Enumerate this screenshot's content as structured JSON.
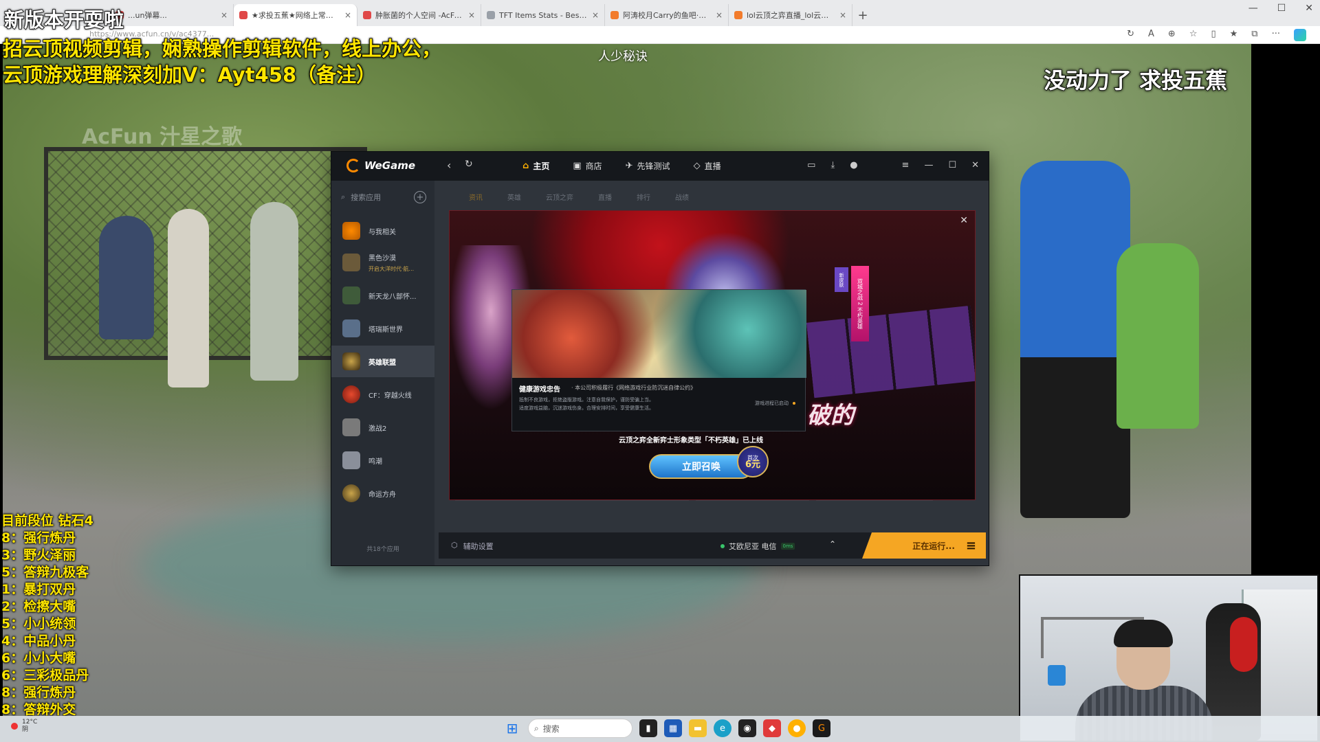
{
  "browser": {
    "tabs": [
      {
        "label": "...un弹幕..."
      },
      {
        "label": "★求投五蕉★网络上常见的热门..."
      },
      {
        "label": "肿胀菌的个人空间 -AcFun弹幕..."
      },
      {
        "label": "TFT Items Stats - Best Items for S..."
      },
      {
        "label": "阿涛校月Carry的鱼吧·斗鱼社区..."
      },
      {
        "label": "lol云顶之弈直播_lol云顶之弈直..."
      }
    ],
    "new_tab": "+",
    "window_controls": {
      "minimize": "—",
      "maximize": "☐",
      "close": "✕"
    },
    "address": "https://www.acfun.cn/v/ac4377..."
  },
  "video": {
    "watermark": "AcFun 汁星之歌",
    "promo_title": "新版本开耍啦",
    "promo_line1": "招云顶视频剪辑，娴熟操作剪辑软件，线上办公，",
    "promo_line2": "云顶游戏理解深刻加V：Ayt458（备注）",
    "center_caption": "人少秘诀",
    "right_caption": "没动力了 求投五蕉",
    "rank_header": "目前段位 钻石4",
    "rank_list": [
      "8：强行炼丹",
      "3：野火泽丽",
      "5：答辩九极客",
      "1：暴打双丹",
      "2：检擦大嘴",
      "5：小小统领",
      "4：中品小丹",
      "6：小小大嘴",
      "6：三彩极品丹",
      "8：强行炼丹",
      "8：答辩外交"
    ]
  },
  "wegame": {
    "logo": "WeGame",
    "nav": {
      "back": "‹",
      "refresh": "↻"
    },
    "tabs": [
      {
        "label": "主页",
        "icon": "home-icon",
        "active": true
      },
      {
        "label": "商店",
        "icon": "shop-icon",
        "active": false
      },
      {
        "label": "先锋测试",
        "icon": "test-icon",
        "active": false
      },
      {
        "label": "直播",
        "icon": "live-icon",
        "active": false
      }
    ],
    "sidebar": {
      "search_placeholder": "搜索应用",
      "items": [
        {
          "label": "与我相关",
          "sub": ""
        },
        {
          "label": "黑色沙漠",
          "sub": "开启大洋时代·航..."
        },
        {
          "label": "新天龙八部怀...",
          "sub": ""
        },
        {
          "label": "塔瑞斯世界",
          "sub": ""
        },
        {
          "label": "英雄联盟",
          "sub": "",
          "active": true
        },
        {
          "label": "CF：穿越火线",
          "sub": ""
        },
        {
          "label": "激战2",
          "sub": ""
        },
        {
          "label": "鸣潮",
          "sub": ""
        },
        {
          "label": "命运方舟",
          "sub": ""
        }
      ],
      "count": "共18个应用"
    },
    "subtabs": [
      "资讯",
      "英雄",
      "云顶之弈",
      "直播",
      "排行",
      "战绩"
    ],
    "popup": {
      "close": "✕",
      "banner_vertical": "双城之战 2 不朽英雄",
      "banner_small": "新皮肤",
      "big_text": "破的",
      "health_title": "健康游戏忠告",
      "health_pledge": "· 本公司积极履行《网络游戏行业防沉迷自律公约》",
      "health_line1": "抵制不良游戏，拒绝盗版游戏。注意自我保护，谨防受骗上当。",
      "health_line2": "适度游戏益脑，沉迷游戏伤身。合理安排时间，享受健康生活。",
      "health_progress": "游戏进程已启动",
      "headline": "云顶之弈全新弈士形象类型「不朽英雄」已上线",
      "button": "立即召唤",
      "badge_top": "首次",
      "badge_price": "6元"
    },
    "status": {
      "assist": "辅助设置",
      "server": "艾欧尼亚 电信",
      "ping": "0ms",
      "running": "正在运行..."
    }
  },
  "taskbar": {
    "temp": "12°C",
    "weather": "阴",
    "search": "搜索"
  },
  "colors": {
    "accent": "#f5a623",
    "promo_yellow": "#ffe600",
    "wegame_bg": "#1d2127"
  }
}
